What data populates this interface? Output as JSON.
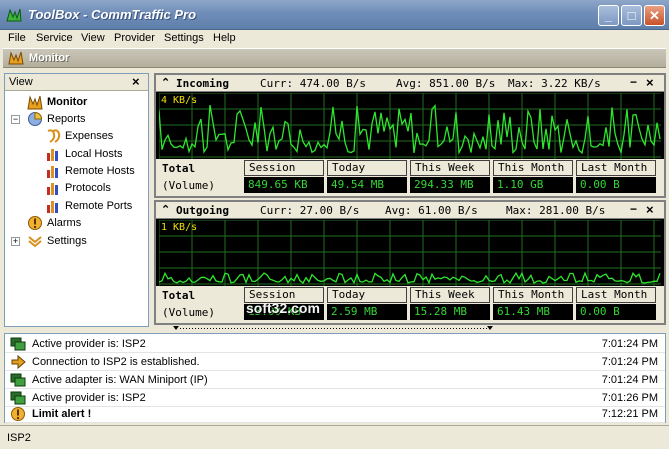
{
  "window": {
    "title": "ToolBox - CommTraffic Pro"
  },
  "menu": {
    "items": [
      "File",
      "Service",
      "View",
      "Provider",
      "Settings",
      "Help"
    ]
  },
  "section": {
    "title": "Monitor"
  },
  "left_panel": {
    "header": "View",
    "close_glyph": "×",
    "tree": [
      {
        "label": "Monitor",
        "icon": "monitor-icon"
      },
      {
        "label": "Reports",
        "icon": "reports-icon",
        "expander": "−"
      },
      {
        "label": "Expenses",
        "icon": "expenses-icon"
      },
      {
        "label": "Local Hosts",
        "icon": "bar-chart-icon"
      },
      {
        "label": "Remote Hosts",
        "icon": "bar-chart-icon"
      },
      {
        "label": "Protocols",
        "icon": "bar-chart-icon"
      },
      {
        "label": "Remote Ports",
        "icon": "bar-chart-icon"
      },
      {
        "label": "Alarms",
        "icon": "alarm-icon"
      },
      {
        "label": "Settings",
        "icon": "settings-icon",
        "expander": "+"
      }
    ]
  },
  "incoming": {
    "title": "Incoming",
    "curr": "Curr: 474.00 B/s",
    "avg": "Avg: 851.00 B/s",
    "max": "Max: 3.22 KB/s",
    "scale": "4 KB/s",
    "total_label": "Total",
    "volume_label": "(Volume)",
    "cells": [
      {
        "label": "Session",
        "value": "849.65 KB"
      },
      {
        "label": "Today",
        "value": "49.54 MB"
      },
      {
        "label": "This Week",
        "value": "294.33 MB"
      },
      {
        "label": "This Month",
        "value": "1.10 GB"
      },
      {
        "label": "Last Month",
        "value": "0.00 B"
      }
    ]
  },
  "outgoing": {
    "title": "Outgoing",
    "curr": "Curr: 27.00 B/s",
    "avg": "Avg: 61.00 B/s",
    "max": "Max: 281.00 B/s",
    "scale": "1 KB/s",
    "total_label": "Total",
    "volume_label": "(Volume)",
    "cells": [
      {
        "label": "Session",
        "value": "13.00 KB"
      },
      {
        "label": "Today",
        "value": "2.59 MB"
      },
      {
        "label": "This Week",
        "value": "15.28 MB"
      },
      {
        "label": "This Month",
        "value": "61.43 MB"
      },
      {
        "label": "Last Month",
        "value": "0.00 B"
      }
    ]
  },
  "panel_glyphs": {
    "minimize": "−",
    "close": "×",
    "chevron": "⌃"
  },
  "log": [
    {
      "icon": "network-icon",
      "message": "Active provider is: ISP2",
      "time": "7:01:24 PM"
    },
    {
      "icon": "connect-arrow-icon",
      "message": "Connection to ISP2 is established.",
      "time": "7:01:24 PM"
    },
    {
      "icon": "network-icon",
      "message": "Active adapter is: WAN Miniport (IP)",
      "time": "7:01:24 PM"
    },
    {
      "icon": "network-icon",
      "message": "Active provider is: ISP2",
      "time": "7:01:26 PM"
    },
    {
      "icon": "alarm-icon",
      "message": "Limit alert !",
      "time": "7:12:21 PM",
      "bold": true
    }
  ],
  "status": {
    "text": "ISP2"
  },
  "watermark": {
    "text": "soft32.com"
  },
  "colors": {
    "graph_line": "#2ee62e",
    "graph_grid": "#1f6e1f",
    "value_text": "#34d634",
    "scale_text": "#f0e000"
  }
}
